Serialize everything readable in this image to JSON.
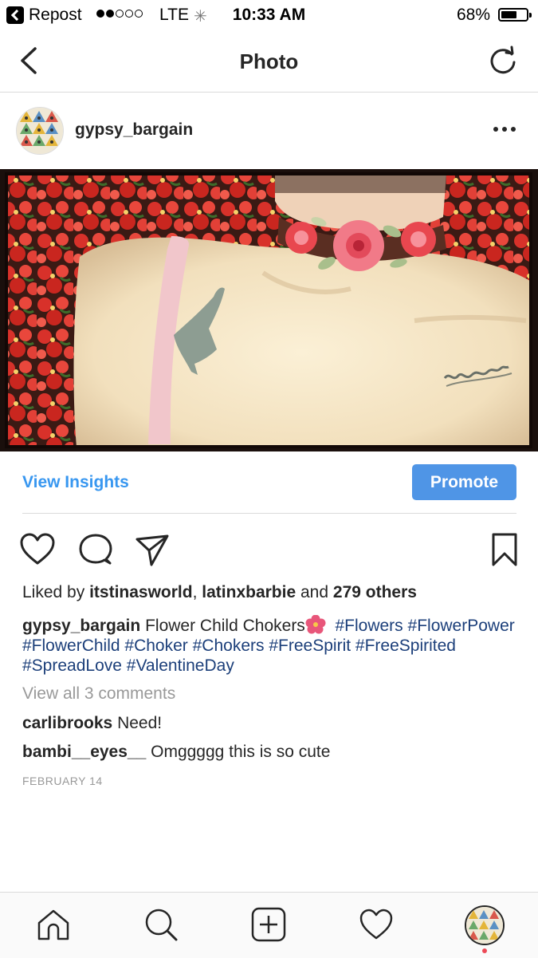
{
  "status_bar": {
    "back_app_label": "Repost",
    "carrier": "LTE",
    "time": "10:33 AM",
    "battery_percent": "68%",
    "battery_level": 0.68,
    "signal_bars": 2,
    "icons": [
      "back-app-icon",
      "signal-dots-icon",
      "activity-spinner-icon",
      "battery-icon"
    ]
  },
  "nav": {
    "title": "Photo",
    "icons": [
      "back-chevron-icon",
      "refresh-icon"
    ]
  },
  "post": {
    "username": "gypsy_bargain",
    "more_icon": "more-dots-icon",
    "photo_description_icon": "photo"
  },
  "insights": {
    "view_label": "View Insights",
    "promote_label": "Promote"
  },
  "actions": {
    "icons": [
      "heart-icon",
      "comment-icon",
      "share-icon",
      "bookmark-icon"
    ]
  },
  "likes": {
    "prefix": "Liked by",
    "user1": "itstinasworld",
    "sep": ",",
    "user2": "latinxbarbie",
    "and": "and",
    "others": "279 others"
  },
  "caption": {
    "username": "gypsy_bargain",
    "text": "Flower Child Chokers",
    "emoji_icon": "hibiscus-emoji-icon",
    "tags": [
      "#Flowers",
      "#FlowerPower",
      "#FlowerChild",
      "#Choker",
      "#Chokers",
      "#FreeSpirit",
      "#FreeSpirited",
      "#SpreadLove",
      "#ValentineDay"
    ]
  },
  "comments": {
    "view_all": "View all 3 comments",
    "items": [
      {
        "user": "carlibrooks",
        "text": "Need!"
      },
      {
        "user": "bambi__eyes__",
        "text": "Omggggg this is so cute"
      }
    ]
  },
  "date": "FEBRUARY 14",
  "tabbar": {
    "icons": [
      "home-icon",
      "search-icon",
      "add-post-icon",
      "activity-heart-icon",
      "profile-avatar-icon"
    ]
  },
  "colors": {
    "link_blue": "#3897f0",
    "promote_blue": "#4f95e6",
    "hashtag_navy": "#1c3f7a",
    "text": "#262626",
    "muted": "#999999",
    "notification_red": "#ed4956"
  }
}
